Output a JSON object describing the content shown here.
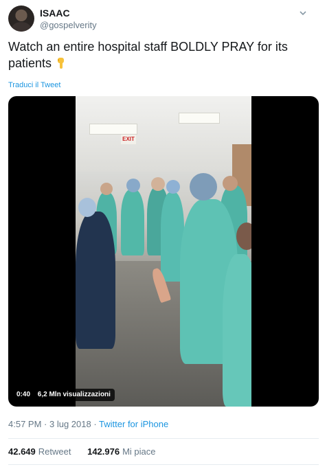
{
  "author": {
    "display_name": "ISAAC",
    "handle": "@gospelverity"
  },
  "tweet": {
    "text": "Watch an entire hospital staff BOLDLY PRAY for its patients",
    "emoji": "pointing-down-hand-emoji",
    "translate_link": "Traduci il Tweet"
  },
  "media": {
    "duration": "0:40",
    "views": "6,2 Mln visualizzazioni",
    "sign_text": "EXIT"
  },
  "meta": {
    "time": "4:57 PM",
    "separator1": " · ",
    "date": "3 lug 2018",
    "separator2": " · ",
    "source": "Twitter for iPhone"
  },
  "stats": {
    "retweets_count": "42.649",
    "retweets_label": "Retweet",
    "likes_count": "142.976",
    "likes_label": "Mi piace"
  },
  "colors": {
    "link": "#1b95e0",
    "secondary_text": "#657786",
    "scrubs": "#4fb3a5"
  }
}
